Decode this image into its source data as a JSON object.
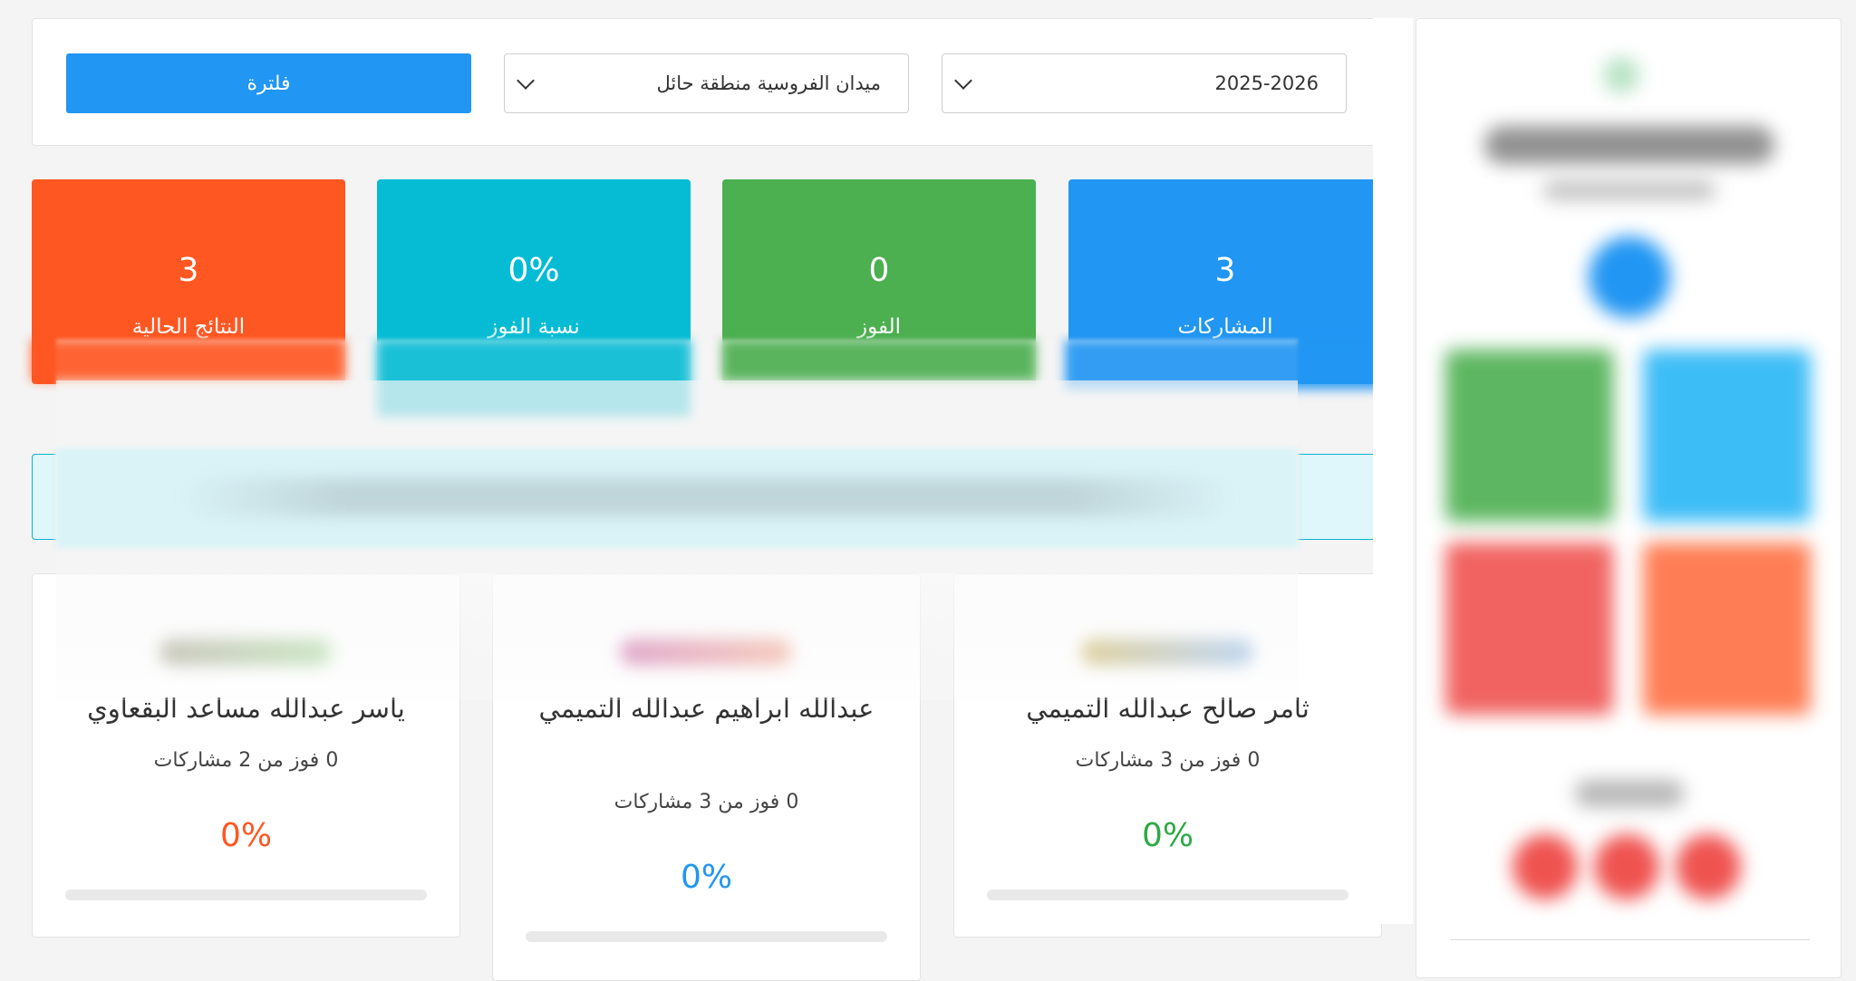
{
  "filters": {
    "season": "2025-2026",
    "venue": "ميدان الفروسية منطقة حائل",
    "button_label": "فلترة"
  },
  "stats": [
    {
      "label": "المشاركات",
      "value": "3",
      "color": "#2196f3"
    },
    {
      "label": "الفوز",
      "value": "0",
      "color": "#4caf50"
    },
    {
      "label": "نسبة الفوز",
      "value": "0%",
      "color": "#06bcd4"
    },
    {
      "label": "النتائج الحالية",
      "value": "3",
      "color": "#ff5722"
    }
  ],
  "riders": [
    {
      "name": "ثامر صالح عبدالله التميمي",
      "summary": "0 فوز من 3 مشاركات",
      "win_pct": "0%",
      "win_ratio": 0,
      "color": "#2eaa45"
    },
    {
      "name": "عبدالله ابراهيم عبدالله التميمي",
      "summary": "0 فوز من 3 مشاركات",
      "win_pct": "0%",
      "win_ratio": 0,
      "color": "#2196f3"
    },
    {
      "name": "ياسر عبدالله مساعد البقعاوي",
      "summary": "0 فوز من 2 مشاركات",
      "win_pct": "0%",
      "win_ratio": 0,
      "color": "#ff5722"
    }
  ],
  "colors": {
    "primary": "#2196f3",
    "success": "#4caf50",
    "info": "#06bcd4",
    "warning": "#ff5722",
    "danger": "#ef5350"
  }
}
